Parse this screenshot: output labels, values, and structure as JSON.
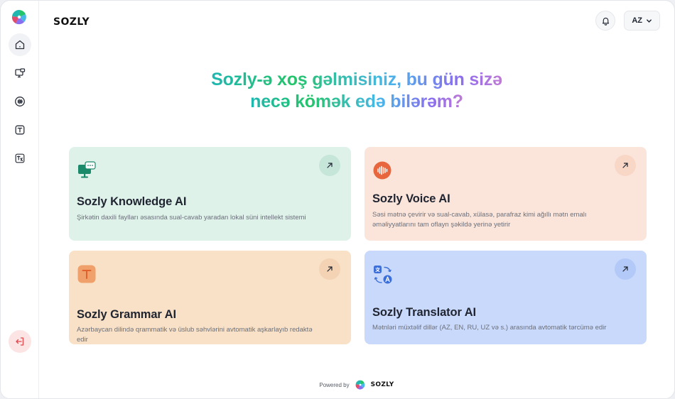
{
  "brand": "SOZLY",
  "header": {
    "language": "AZ"
  },
  "hero": {
    "line1": "Sozly-ə xoş gəlmisiniz, bu gün sizə",
    "line2": "necə kömək edə bilərəm?"
  },
  "sidebar": {
    "items": [
      {
        "icon": "home-icon",
        "active": true
      },
      {
        "icon": "knowledge-icon"
      },
      {
        "icon": "voice-icon"
      },
      {
        "icon": "grammar-icon"
      },
      {
        "icon": "translator-icon"
      }
    ],
    "logout_icon": "logout-icon"
  },
  "cards": [
    {
      "title": "Sozly Knowledge AI",
      "description": "Şirkətin daxili faylları əsasında sual-cavab yaradan lokal süni intellekt sistemi",
      "icon": "knowledge-monitor-icon",
      "accent": "#1b8a6b"
    },
    {
      "title": "Sozly Voice AI",
      "description": "Səsi mətnə çevirir və sual-cavab, xülasə, parafraz kimi ağıllı mətn emalı əməliyyatlarını tam oflayn şəkildə yerinə yetirir",
      "icon": "voice-wave-icon",
      "accent": "#e8663d"
    },
    {
      "title": "Sozly Grammar AI",
      "description": "Azərbaycan dilində qrammatik və üslub səhvlərini avtomatik aşkarlayıb redaktə edir",
      "icon": "grammar-text-icon",
      "accent": "#f0a06a"
    },
    {
      "title": "Sozly Translator AI",
      "description": "Mətnləri müxtəlif dillər (AZ, EN, RU, UZ və s.) arasında avtomatik tərcümə edir",
      "icon": "translate-icon",
      "accent": "#3d6fd9"
    }
  ],
  "footer": {
    "powered_by": "Powered by",
    "brand": "SOZLY"
  }
}
